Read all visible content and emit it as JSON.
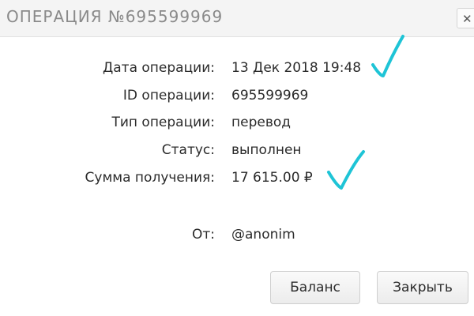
{
  "dialog": {
    "title": "ОПЕРАЦИЯ №695599969",
    "close_glyph": "✕"
  },
  "details": [
    {
      "label": "Дата операции:",
      "value": "13 Дек 2018 19:48"
    },
    {
      "label": "ID операции:",
      "value": "695599969"
    },
    {
      "label": "Тип операции:",
      "value": "перевод"
    },
    {
      "label": "Статус:",
      "value": "выполнен"
    },
    {
      "label": "Сумма получения:",
      "value": "17 615.00 ₽"
    }
  ],
  "sender": {
    "label": "От:",
    "value": "@anonim"
  },
  "buttons": {
    "balance": "Баланс",
    "close": "Закрыть"
  },
  "colors": {
    "checkmark": "#1ec4d6"
  }
}
